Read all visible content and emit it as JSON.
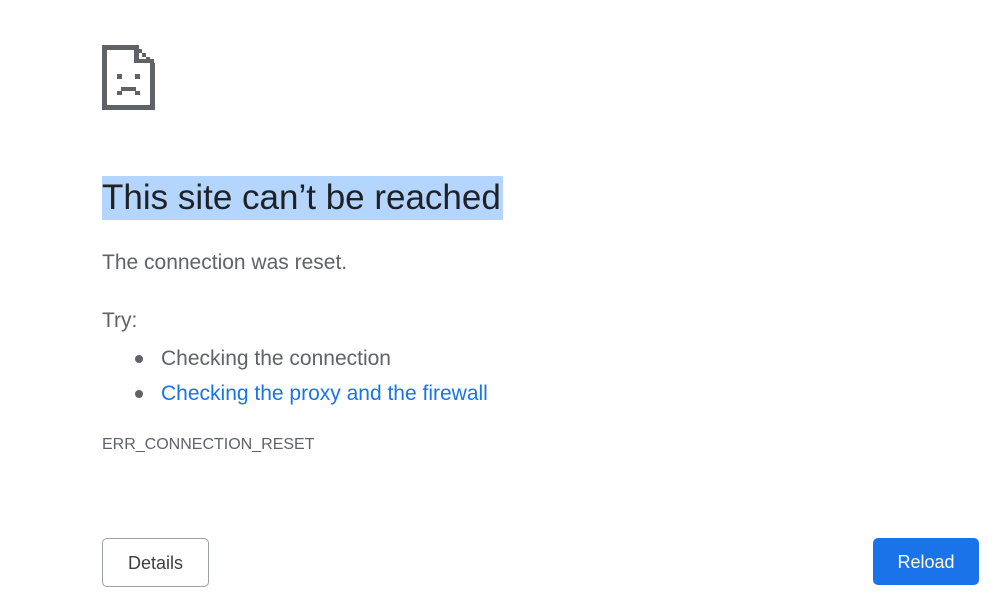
{
  "error_page": {
    "icon": "sad-page-icon",
    "title": "This site can’t be reached",
    "message": "The connection was reset.",
    "try_label": "Try:",
    "suggestions": [
      {
        "text": "Checking the connection",
        "is_link": false
      },
      {
        "text": "Checking the proxy and the firewall",
        "is_link": true
      }
    ],
    "error_code": "ERR_CONNECTION_RESET"
  },
  "buttons": {
    "details_label": "Details",
    "reload_label": "Reload"
  },
  "colors": {
    "title_text": "#202124",
    "body_text": "#5f6368",
    "link": "#1a73e8",
    "selection_highlight": "#b4d5fe",
    "primary_button": "#1a73e8"
  }
}
